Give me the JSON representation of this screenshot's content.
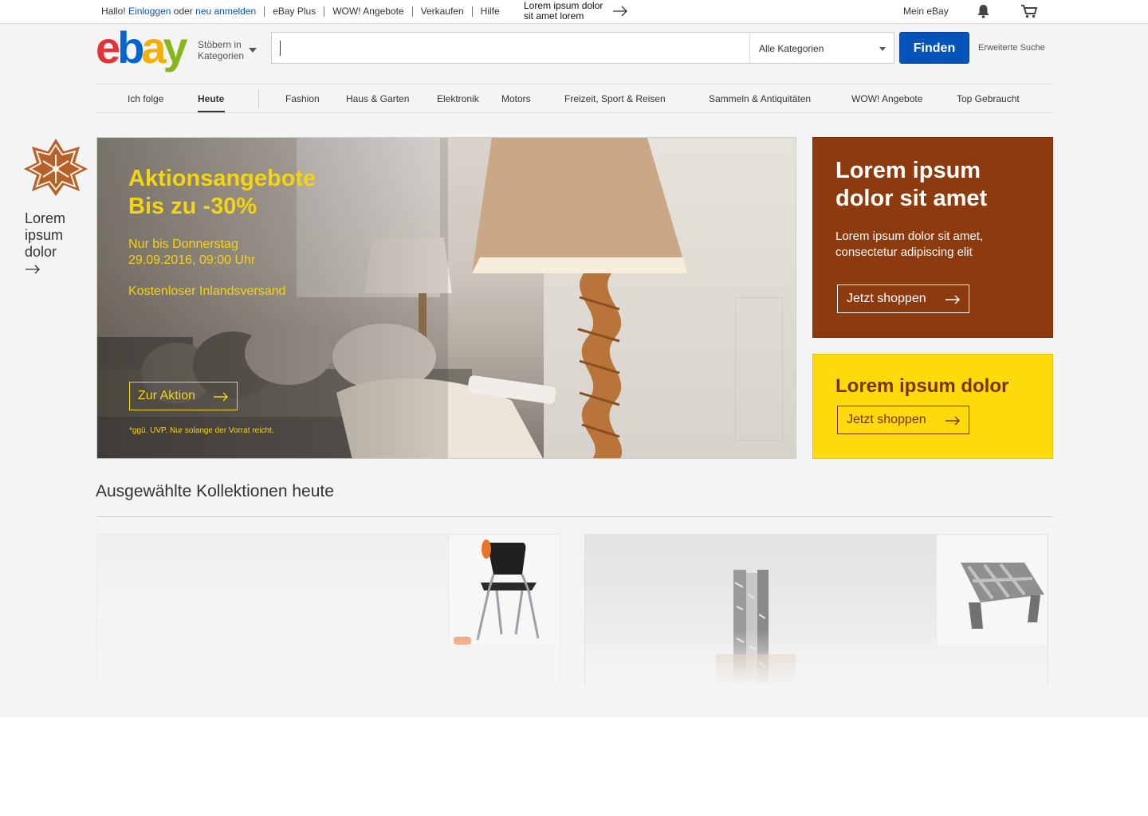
{
  "topbar": {
    "greeting": "Hallo!",
    "login": "Einloggen",
    "or": "oder",
    "register": "neu anmelden",
    "links": [
      "eBay Plus",
      "WOW! Angebote",
      "Verkaufen",
      "Hilfe"
    ],
    "promo_line1": "Lorem ipsum dolor",
    "promo_line2": "sit amet lorem",
    "my_ebay": "Mein eBay"
  },
  "header": {
    "logo": {
      "e": "e",
      "b": "b",
      "a": "a",
      "y": "y"
    },
    "browse_line1": "Stöbern in",
    "browse_line2": "Kategorien",
    "search_value": "",
    "category_selected": "Alle Kategorien",
    "find_label": "Finden",
    "advanced_label": "Erweiterte Suche"
  },
  "nav": {
    "items": [
      "Ich folge",
      "Heute",
      "Fashion",
      "Haus & Garten",
      "Elektronik",
      "Motors",
      "Freizeit, Sport & Reisen",
      "Sammeln & Antiquitäten",
      "WOW! Angebote",
      "Top Gebraucht"
    ],
    "active": "Heute"
  },
  "side_promo": {
    "line1": "Lorem",
    "line2": "ipsum",
    "line3": "dolor"
  },
  "hero": {
    "title_line1": "Aktionsangebote",
    "title_line2": "Bis zu -30%",
    "date_line1": "Nur bis Donnerstag",
    "date_line2": "29.09.2016, 09:00 Uhr",
    "shipping": "Kostenloser Inlandsversand",
    "button": "Zur Aktion",
    "note": "*ggü. UVP. Nur solange der Vorrat reicht."
  },
  "promo_brown": {
    "title_line1": "Lorem ipsum",
    "title_line2": "dolor sit amet",
    "text_line1": "Lorem ipsum dolor sit amet,",
    "text_line2": "consectetur adipiscing elit",
    "button": "Jetzt shoppen"
  },
  "promo_yellow": {
    "title": "Lorem ipsum dolor",
    "button": "Jetzt shoppen"
  },
  "collections": {
    "title": "Ausgewählte Kollektionen heute"
  },
  "colors": {
    "brand_blue": "#0654ba",
    "promo_yellow_text": "#f5d410",
    "promo_brown_bg": "#8c3a0e",
    "promo_yellow_bg": "#fdda0b"
  }
}
